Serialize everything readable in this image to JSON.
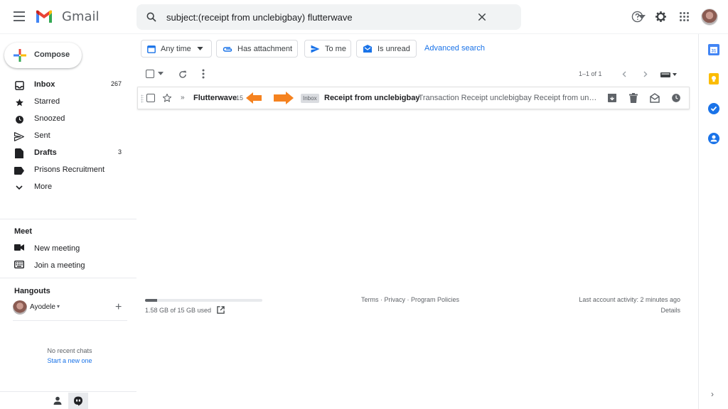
{
  "header": {
    "app_name": "Gmail",
    "search_value": "subject:(receipt from unclebigbay) flutterwave",
    "icons": [
      "menu-icon",
      "gmail-logo",
      "search-icon",
      "clear-icon",
      "search-options-icon",
      "help-icon",
      "gear-icon",
      "apps-icon",
      "avatar"
    ]
  },
  "sidebar": {
    "compose_label": "Compose",
    "items": [
      {
        "label": "Inbox",
        "count": "267",
        "icon": "inbox-icon",
        "bold": true
      },
      {
        "label": "Starred",
        "count": "",
        "icon": "star-icon",
        "bold": false
      },
      {
        "label": "Snoozed",
        "count": "",
        "icon": "clock-icon",
        "bold": false
      },
      {
        "label": "Sent",
        "count": "",
        "icon": "send-icon",
        "bold": false
      },
      {
        "label": "Drafts",
        "count": "3",
        "icon": "draft-icon",
        "bold": true
      },
      {
        "label": "Prisons Recruitment",
        "count": "",
        "icon": "label-icon",
        "bold": false
      },
      {
        "label": "More",
        "count": "",
        "icon": "chevron-down-icon",
        "bold": false
      }
    ],
    "meet": {
      "title": "Meet",
      "new_meeting": "New meeting",
      "join_meeting": "Join a meeting"
    },
    "hangouts": {
      "title": "Hangouts",
      "user": "Ayodele",
      "no_chats": "No recent chats",
      "start_chat": "Start a new one"
    }
  },
  "filters": {
    "any_time": "Any time",
    "has_attachment": "Has attachment",
    "to_me": "To me",
    "is_unread": "Is unread",
    "advanced_search": "Advanced search"
  },
  "toolbar": {
    "range": "1–1 of 1"
  },
  "email": {
    "sender": "Flutterwave",
    "thread_count": "15",
    "badge": "Inbox",
    "subject": "Receipt from unclebigbay",
    "snippet": " - Transaction Receipt unclebigbay Receipt from uncl..."
  },
  "footer": {
    "storage_text": "1.58 GB of 15 GB used",
    "storage_fraction": 0.105,
    "links": "Terms · Privacy · Program Policies",
    "last_activity": "Last account activity: 2 minutes ago",
    "details": "Details"
  },
  "colors": {
    "accent": "#1a73e8",
    "annotation_arrow": "#f5821f",
    "text_primary": "#202124",
    "text_secondary": "#5f6368"
  }
}
